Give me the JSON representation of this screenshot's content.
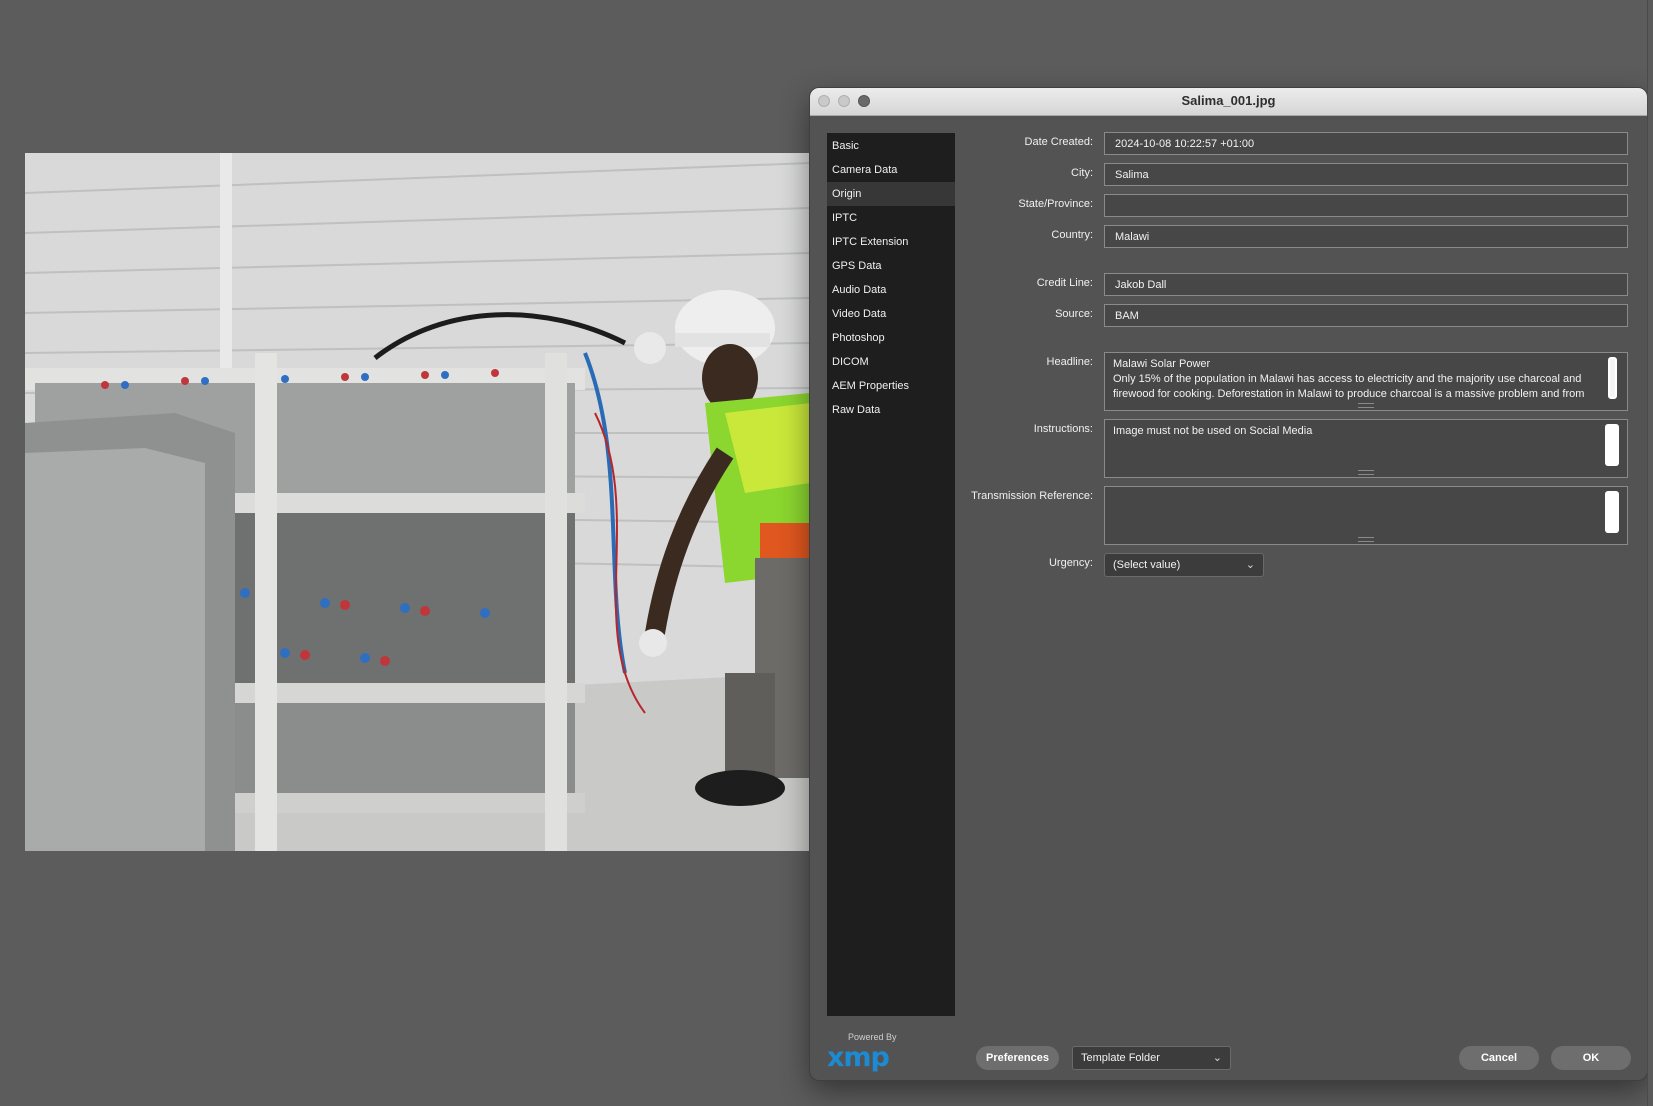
{
  "window": {
    "title": "Salima_001.jpg"
  },
  "sidebar": {
    "items": [
      {
        "label": "Basic",
        "active": false
      },
      {
        "label": "Camera Data",
        "active": false
      },
      {
        "label": "Origin",
        "active": true
      },
      {
        "label": "IPTC",
        "active": false
      },
      {
        "label": "IPTC Extension",
        "active": false
      },
      {
        "label": "GPS Data",
        "active": false
      },
      {
        "label": "Audio Data",
        "active": false
      },
      {
        "label": "Video Data",
        "active": false
      },
      {
        "label": "Photoshop",
        "active": false
      },
      {
        "label": "DICOM",
        "active": false
      },
      {
        "label": "AEM Properties",
        "active": false
      },
      {
        "label": "Raw Data",
        "active": false
      }
    ]
  },
  "form": {
    "date_created": {
      "label": "Date Created:",
      "value": "2024-10-08 10:22:57 +01:00"
    },
    "city": {
      "label": "City:",
      "value": "Salima"
    },
    "state": {
      "label": "State/Province:",
      "value": ""
    },
    "country": {
      "label": "Country:",
      "value": "Malawi"
    },
    "credit_line": {
      "label": "Credit Line:",
      "value": "Jakob Dall"
    },
    "source": {
      "label": "Source:",
      "value": "BAM"
    },
    "headline": {
      "label": "Headline:",
      "lines": [
        "Malawi Solar Power",
        "Only 15% of the population in Malawi has access to electricity and the majority use charcoal and",
        "firewood for cooking. Deforestation in Malawi to produce charcoal is a massive problem and from"
      ]
    },
    "instructions": {
      "label": "Instructions:",
      "value": "Image must not be used on Social Media"
    },
    "transmission_reference": {
      "label": "Transmission Reference:",
      "value": ""
    },
    "urgency": {
      "label": "Urgency:",
      "selected": "(Select value)"
    }
  },
  "footer": {
    "powered_by": "Powered By",
    "logo_text": "xmp",
    "preferences_label": "Preferences",
    "template_folder": "Template Folder",
    "cancel_label": "Cancel",
    "ok_label": "OK"
  },
  "colors": {
    "background": "#5c5c5c",
    "dialog": "#535353",
    "sidebar": "#1e1e1e",
    "xmp_blue": "#1d8ad4"
  },
  "icons": {
    "dropdown": "chevron-down-icon"
  }
}
